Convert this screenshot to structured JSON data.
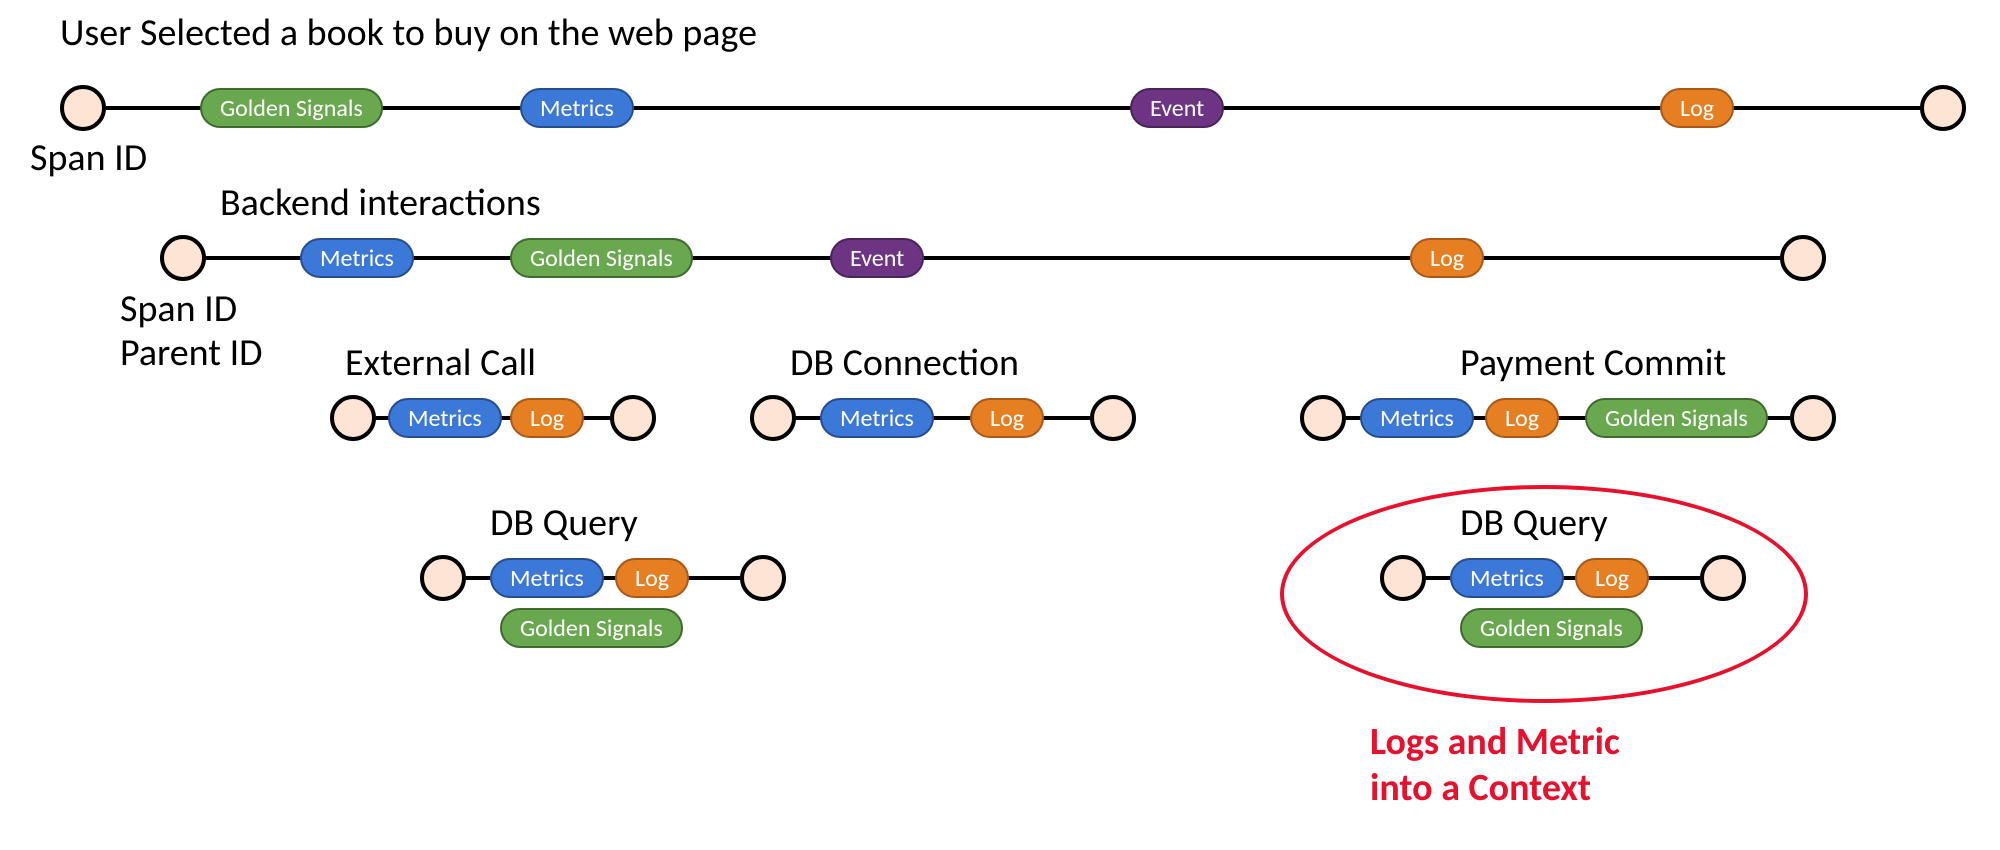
{
  "labels": {
    "span_id": "Span ID",
    "parent_id": "Parent ID",
    "metrics": "Metrics",
    "log": "Log",
    "event": "Event",
    "golden_signals": "Golden Signals"
  },
  "spans": {
    "root": {
      "title": "User Selected a book to buy on the web page"
    },
    "backend": {
      "title": "Backend interactions"
    },
    "external_call": {
      "title": "External Call"
    },
    "db_connection": {
      "title": "DB Connection"
    },
    "payment_commit": {
      "title": "Payment Commit"
    },
    "db_query_1": {
      "title": "DB Query"
    },
    "db_query_2": {
      "title": "DB Query"
    }
  },
  "callout": {
    "line1": "Logs and Metric",
    "line2": "into a Context"
  }
}
